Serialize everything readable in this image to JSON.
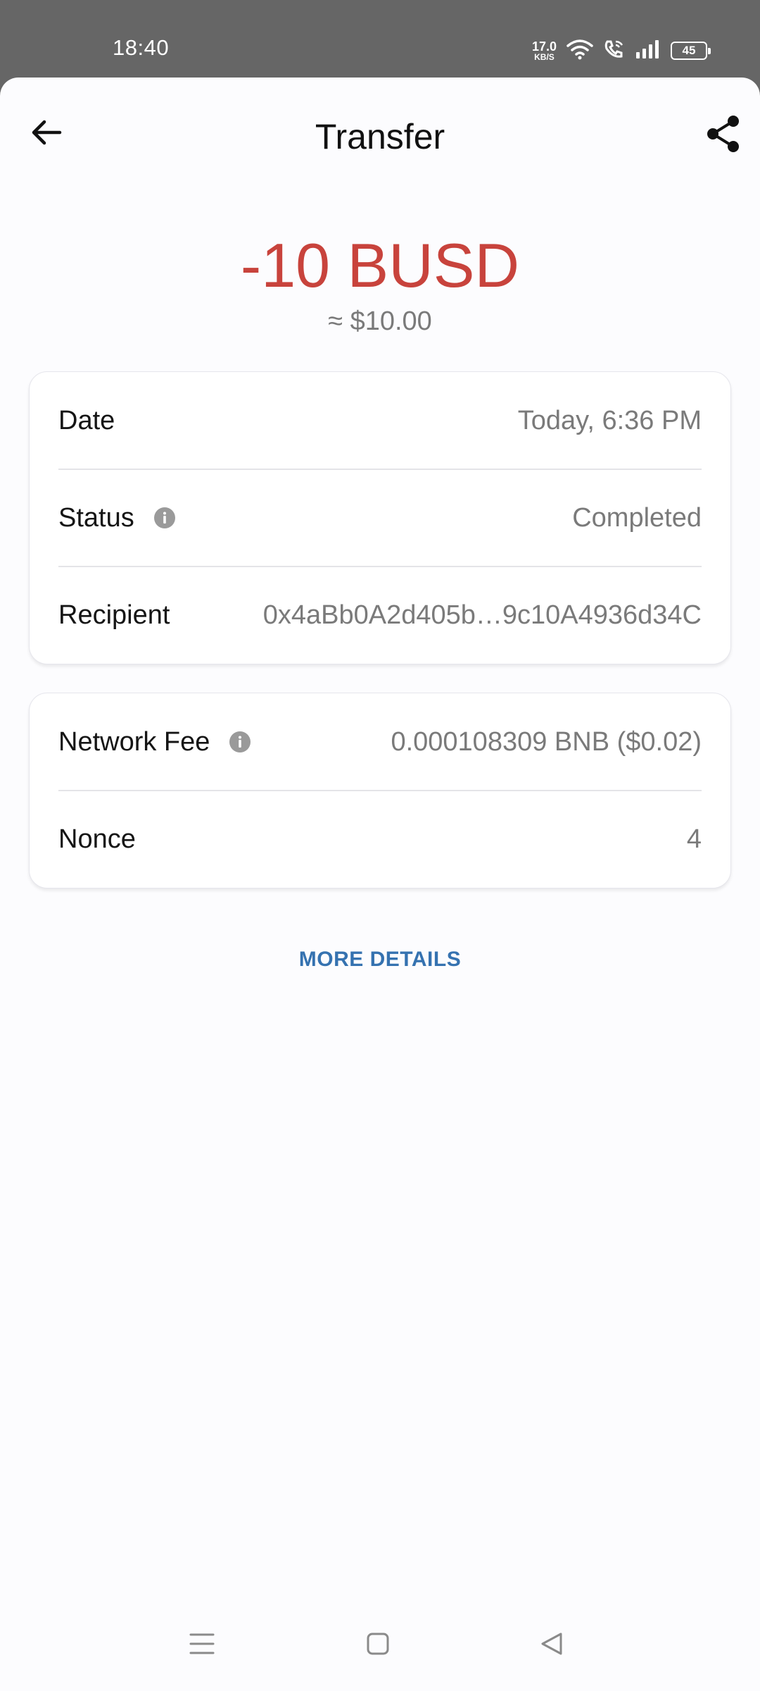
{
  "status_bar": {
    "time": "18:40",
    "net_speed_value": "17.0",
    "net_speed_unit": "KB/S",
    "battery": "45"
  },
  "header": {
    "title": "Transfer",
    "back_icon": "arrow-left-icon",
    "share_icon": "share-icon"
  },
  "summary": {
    "amount": "-10 BUSD",
    "amount_color": "#c8433c",
    "fiat": "≈ $10.00"
  },
  "details_card": {
    "rows": [
      {
        "label": "Date",
        "value": "Today, 6:36 PM"
      },
      {
        "label": "Status",
        "value": "Completed"
      },
      {
        "label": "Recipient",
        "value": "0x4aBb0A2d405b…9c10A4936d34C"
      }
    ]
  },
  "fee_card": {
    "rows": [
      {
        "label": "Network Fee",
        "value": "0.000108309 BNB ($0.02)"
      },
      {
        "label": "Nonce",
        "value": "4"
      }
    ]
  },
  "more_details_label": "MORE DETAILS",
  "link_color": "#3572b0",
  "nav_bar": {
    "icons": [
      "menu-icon",
      "home-square-icon",
      "back-triangle-icon"
    ]
  }
}
